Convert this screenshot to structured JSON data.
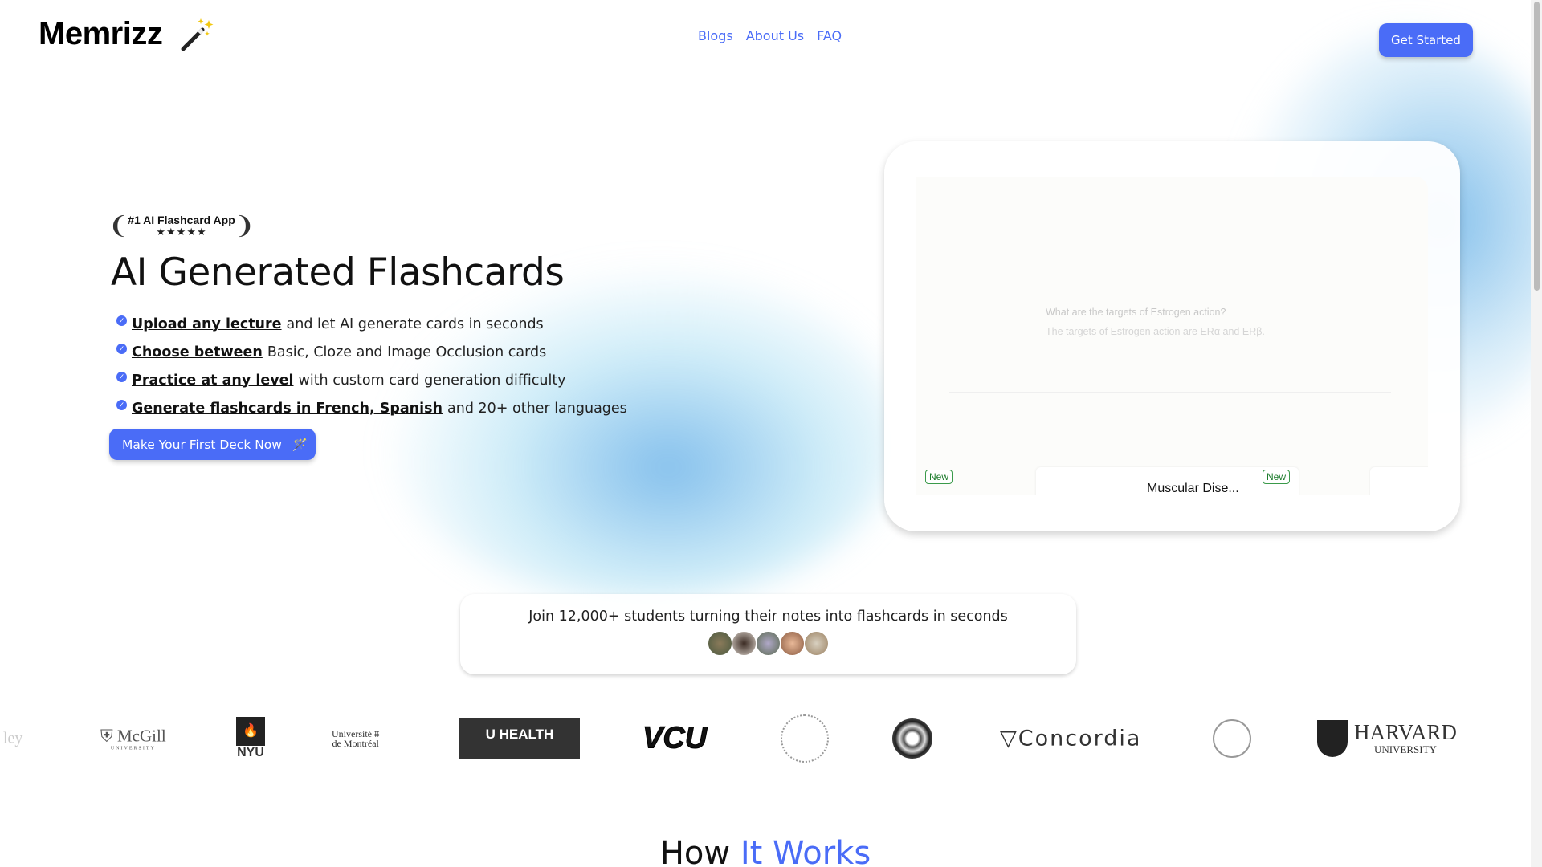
{
  "brand": {
    "name": "Memrizz",
    "icon": "magic-wand-icon"
  },
  "nav": {
    "items": [
      "Blogs",
      "About Us",
      "FAQ"
    ],
    "cta": "Get Started",
    "accent": "#4a6cf7"
  },
  "hero": {
    "badge": {
      "title": "#1 AI Flashcard App",
      "stars": "★★★★★",
      "rating": 5
    },
    "title": "AI Generated Flashcards",
    "bullets": [
      {
        "strong": "Upload any lecture",
        "rest": "and let AI generate cards in seconds"
      },
      {
        "strong": "Choose between",
        "rest": "Basic, Cloze and Image Occlusion cards"
      },
      {
        "strong": "Practice at any level",
        "rest": "with custom card generation difficulty"
      },
      {
        "strong": "Generate flashcards in French, Spanish",
        "rest": "and 20+ other languages"
      }
    ],
    "cta": "Make Your First Deck Now"
  },
  "demo": {
    "question": "What are the targets of Estrogen action?",
    "answer": "The targets of Estrogen action are ERα and ERβ.",
    "new_label": "New",
    "deck_title": "Muscular Dise..."
  },
  "social": {
    "text": "Join 12,000+ students turning their notes into flashcards in seconds",
    "avatar_count": 5
  },
  "logos": [
    "Berkeley",
    "McGill University",
    "NYU",
    "Université de Montréal",
    "Health University of Utah",
    "VCU",
    "College seal",
    "University seal",
    "Université Concordia University",
    "University crest",
    "Harvard University"
  ],
  "next_section": {
    "title_a": "How",
    "title_b": "It Works"
  }
}
